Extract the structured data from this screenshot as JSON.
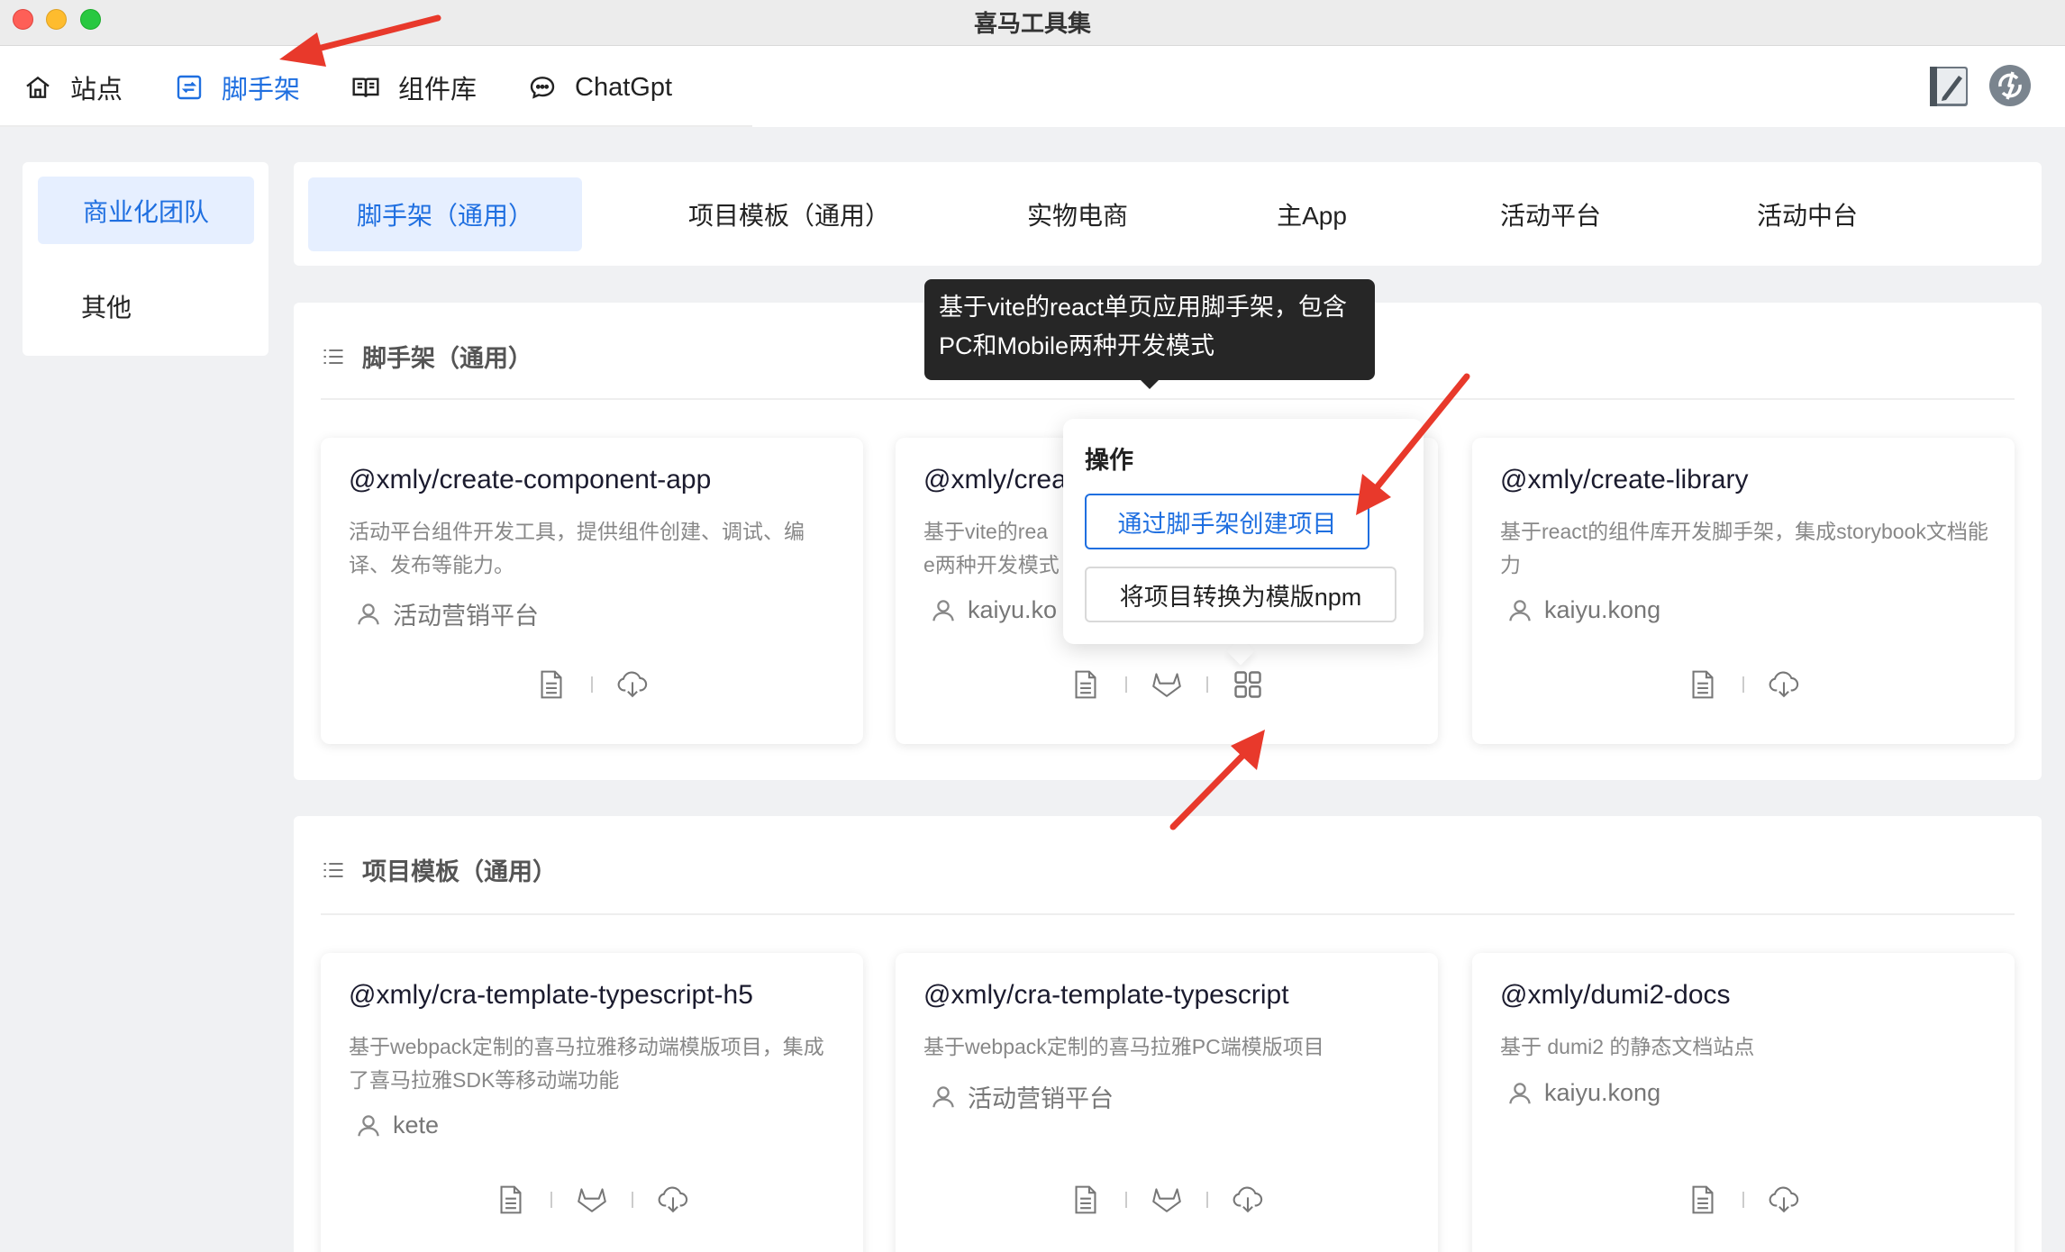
{
  "window": {
    "title": "喜马工具集"
  },
  "topnav": {
    "items": [
      {
        "label": "站点",
        "icon": "home-icon",
        "active": false
      },
      {
        "label": "脚手架",
        "icon": "scaffold-icon",
        "active": true
      },
      {
        "label": "组件库",
        "icon": "book-icon",
        "active": false
      },
      {
        "label": "ChatGpt",
        "icon": "chat-icon",
        "active": false
      }
    ],
    "right_icons": [
      "notebook-icon",
      "sync-icon"
    ]
  },
  "sidebar": {
    "items": [
      {
        "label": "商业化团队",
        "active": true
      },
      {
        "label": "其他",
        "active": false
      }
    ]
  },
  "tabs": [
    {
      "label": "脚手架（通用）",
      "active": true
    },
    {
      "label": "项目模板（通用）",
      "active": false
    },
    {
      "label": "实物电商",
      "active": false
    },
    {
      "label": "主App",
      "active": false
    },
    {
      "label": "活动平台",
      "active": false
    },
    {
      "label": "活动中台",
      "active": false
    }
  ],
  "sections": [
    {
      "title": "脚手架（通用）",
      "cards": [
        {
          "title": "@xmly/create-component-app",
          "desc": "活动平台组件开发工具，提供组件创建、调试、编译、发布等能力。",
          "author": "活动营销平台",
          "actions": [
            "doc-icon",
            "download-icon"
          ]
        },
        {
          "title": "@xmly/crea",
          "desc": "基于vite的rea\ne两种开发模式",
          "author": "kaiyu.ko",
          "actions": [
            "doc-icon",
            "gitlab-icon",
            "grid-icon"
          ]
        },
        {
          "title": "@xmly/create-library",
          "desc": "基于react的组件库开发脚手架，集成storybook文档能力",
          "author": "kaiyu.kong",
          "actions": [
            "doc-icon",
            "download-icon"
          ]
        }
      ]
    },
    {
      "title": "项目模板（通用）",
      "cards": [
        {
          "title": "@xmly/cra-template-typescript-h5",
          "desc": "基于webpack定制的喜马拉雅移动端模版项目，集成了喜马拉雅SDK等移动端功能",
          "author": "kete",
          "actions": [
            "doc-icon",
            "gitlab-icon",
            "download-icon"
          ]
        },
        {
          "title": "@xmly/cra-template-typescript",
          "desc": "基于webpack定制的喜马拉雅PC端模版项目",
          "author": "活动营销平台",
          "actions": [
            "doc-icon",
            "gitlab-icon",
            "download-icon"
          ]
        },
        {
          "title": "@xmly/dumi2-docs",
          "desc": "基于 dumi2 的静态文档站点",
          "author": "kaiyu.kong",
          "actions": [
            "doc-icon",
            "download-icon"
          ]
        }
      ]
    }
  ],
  "tooltip": {
    "text": "基于vite的react单页应用脚手架，包含PC和Mobile两种开发模式"
  },
  "popover": {
    "title": "操作",
    "buttons": [
      "通过脚手架创建项目",
      "将项目转换为模版npm"
    ]
  },
  "colors": {
    "accent": "#1f6fe0",
    "annotation": "#e8392b",
    "active_bg": "#e6efff"
  }
}
